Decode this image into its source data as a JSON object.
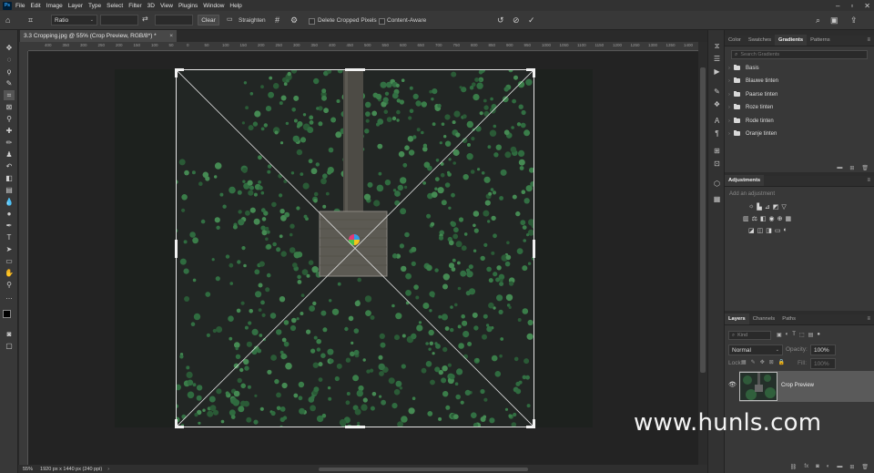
{
  "app": {
    "logo": "Ps",
    "menus": [
      "File",
      "Edit",
      "Image",
      "Layer",
      "Type",
      "Select",
      "Filter",
      "3D",
      "View",
      "Plugins",
      "Window",
      "Help"
    ]
  },
  "options_bar": {
    "ratio_label": "Ratio",
    "clear_label": "Clear",
    "straighten_label": "Straighten",
    "delete_cropped_label": "Delete Cropped Pixels",
    "content_aware_label": "Content-Aware"
  },
  "document": {
    "tab_title": "3.3 Cropping.jpg @ 55% (Crop Preview, RGB/8*) *",
    "close": "×",
    "zoom": "55%",
    "info": "1920 px x 1440 px (240 ppi)"
  },
  "ruler_labels": [
    "400",
    "350",
    "300",
    "250",
    "200",
    "150",
    "100",
    "50",
    "0",
    "50",
    "100",
    "150",
    "200",
    "250",
    "300",
    "350",
    "400",
    "450",
    "500",
    "550",
    "600",
    "650",
    "700",
    "750",
    "800",
    "850",
    "900",
    "950",
    "1000",
    "1050",
    "1100",
    "1150",
    "1200",
    "1250",
    "1300",
    "1350",
    "1400",
    "1450"
  ],
  "panels": {
    "top_tabs": [
      "Color",
      "Swatches",
      "Gradients",
      "Patterns"
    ],
    "search_placeholder": "Search Gradients",
    "gradient_groups": [
      "Basis",
      "Blauwe tinten",
      "Paarse tinten",
      "Roze tinten",
      "Rode tinten",
      "Oranje tinten"
    ],
    "adjustments_title": "Adjustments",
    "add_adjustment": "Add an adjustment",
    "layer_tabs": [
      "Layers",
      "Channels",
      "Paths"
    ],
    "kind_label": "Kind",
    "blend_mode": "Normal",
    "opacity_label": "Opacity:",
    "opacity_value": "100%",
    "lock_label": "Lock:",
    "fill_label": "Fill:",
    "fill_value": "100%",
    "layer_name": "Crop Preview"
  },
  "watermark": "www.hunls.com",
  "colors": {
    "accent_blue": "#31a8ff",
    "panel_bg": "#383838",
    "canvas_bg": "#232323"
  }
}
